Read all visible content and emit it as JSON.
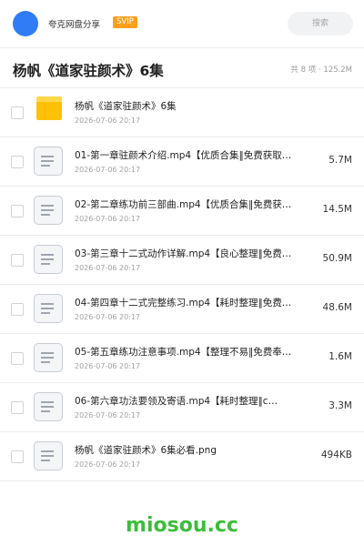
{
  "header": {
    "app_name": "夸克网盘分享",
    "badge": "SVIP",
    "search_placeholder": "搜索",
    "avatar_color": "#2f7cf6",
    "badge_color": "#ff9f1c"
  },
  "folder": {
    "title": "杨帆《道家驻颜术》6集",
    "summary": "共 8 项 · 125.2M"
  },
  "files": [
    {
      "name": "杨帆《道家驻颜术》6集",
      "date": "2026-07-06 20:17",
      "size": "",
      "icon": "folder-icon"
    },
    {
      "name": "01-第一章驻颜术介绍.mp4【优质合集‖免费获取…",
      "date": "2026-07-06 20:17",
      "size": "5.7M",
      "icon": "file-icon"
    },
    {
      "name": "02-第二章练功前三部曲.mp4【优质合集‖免费获…",
      "date": "2026-07-06 20:17",
      "size": "14.5M",
      "icon": "file-icon"
    },
    {
      "name": "03-第三章十二式动作详解.mp4【良心整理‖免费…",
      "date": "2026-07-06 20:17",
      "size": "50.9M",
      "icon": "file-icon"
    },
    {
      "name": "04-第四章十二式完整练习.mp4【耗时整理‖免费…",
      "date": "2026-07-06 20:17",
      "size": "48.6M",
      "icon": "file-icon"
    },
    {
      "name": "05-第五章练功注意事项.mp4【整理不易‖免费奉…",
      "date": "2026-07-06 20:17",
      "size": "1.6M",
      "icon": "file-icon"
    },
    {
      "name": "06-第六章功法要领及寄语.mp4【耗时整理‖c…",
      "date": "2026-07-06 20:17",
      "size": "3.3M",
      "icon": "file-icon"
    },
    {
      "name": "杨帆《道家驻颜术》6集必看.png",
      "date": "2026-07-06 20:17",
      "size": "494KB",
      "icon": "file-icon"
    }
  ],
  "watermark": "miosou.cc",
  "watermark_color": "#3cbd3c"
}
